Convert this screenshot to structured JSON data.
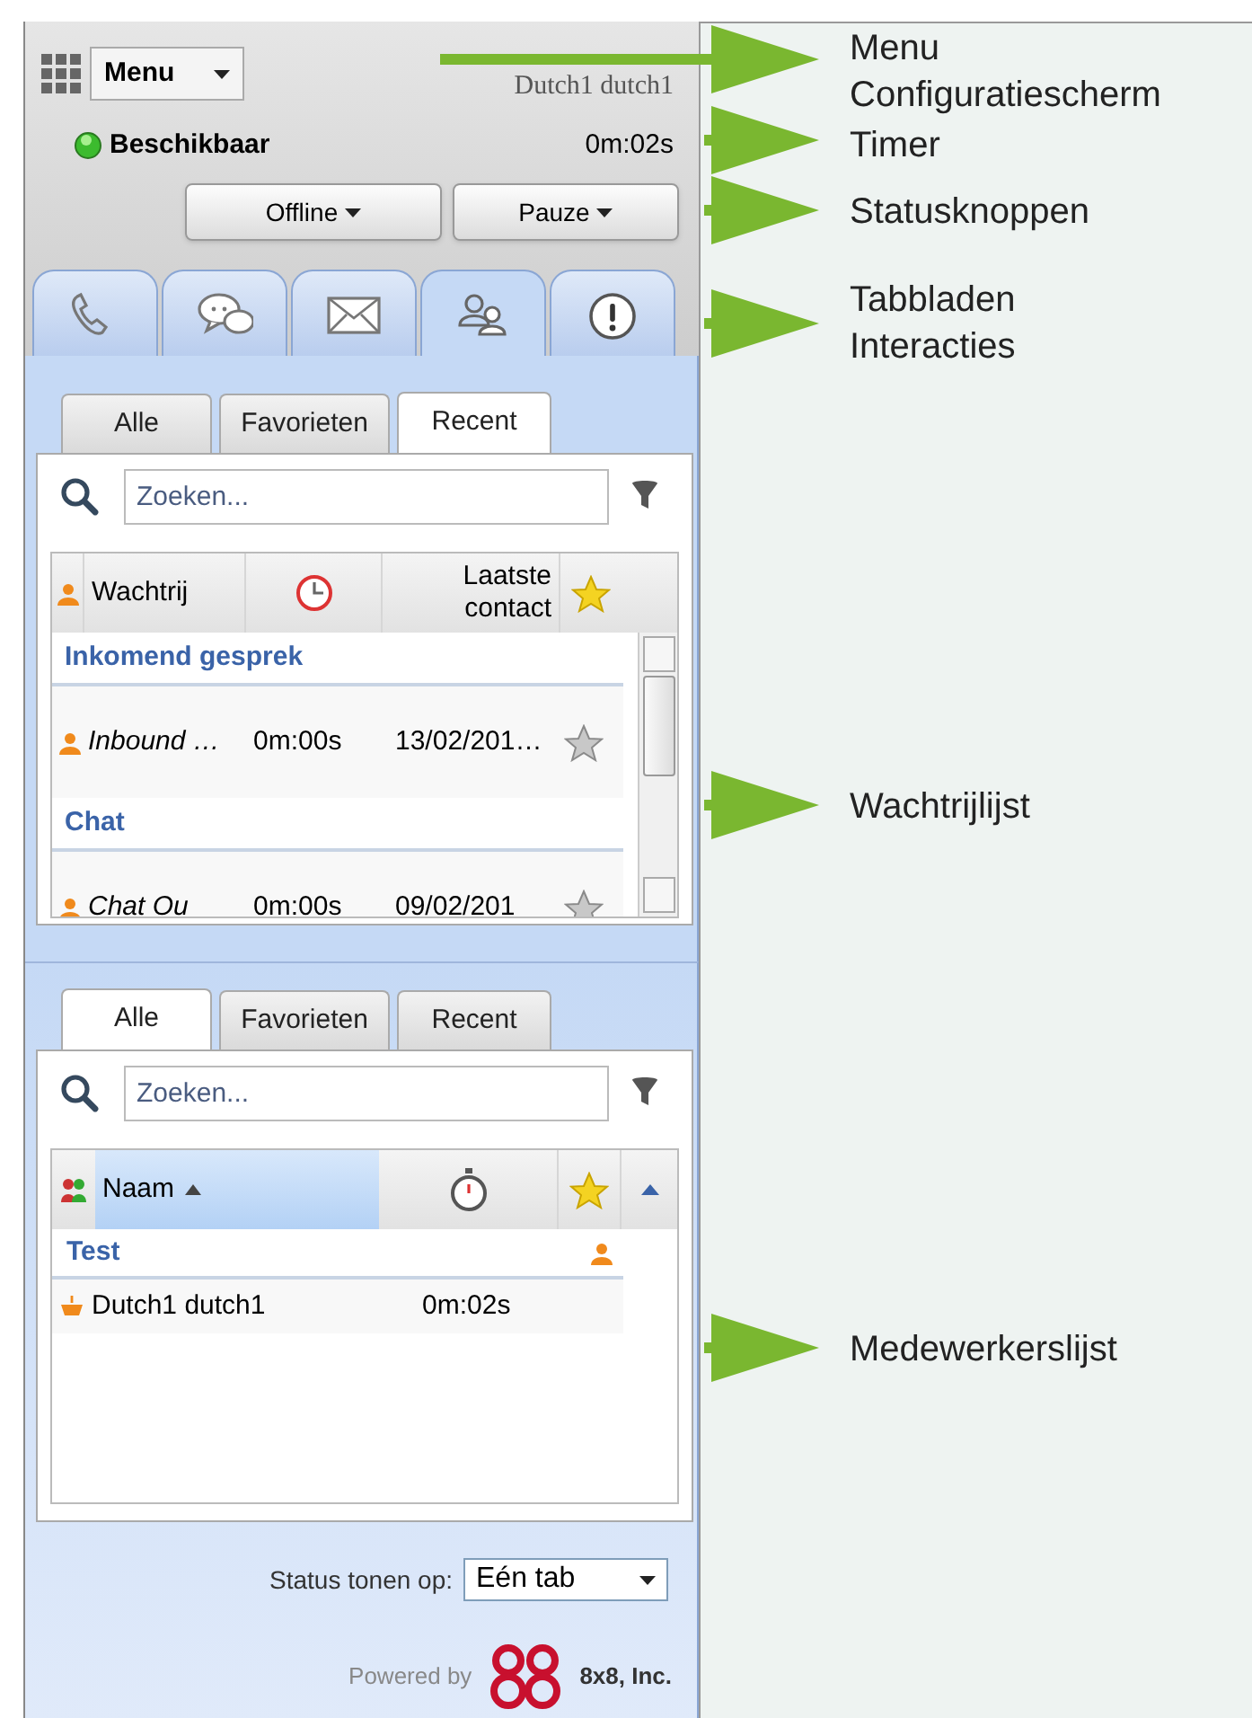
{
  "header": {
    "menu_button": "Menu",
    "user_name": "Dutch1 dutch1"
  },
  "status": {
    "label": "Beschikbaar",
    "timer": "0m:02s"
  },
  "status_buttons": [
    "Offline",
    "Pauze"
  ],
  "interaction_tabs": [
    {
      "kind": "phone",
      "selected": false
    },
    {
      "kind": "chat",
      "selected": false
    },
    {
      "kind": "mail",
      "selected": false
    },
    {
      "kind": "agents",
      "selected": true
    },
    {
      "kind": "alert",
      "selected": false
    }
  ],
  "queue_list": {
    "tabs": [
      {
        "label": "Alle",
        "selected": false
      },
      {
        "label": "Favorieten",
        "selected": false
      },
      {
        "label": "Recent",
        "selected": true
      }
    ],
    "search": {
      "placeholder": "Zoeken..."
    },
    "columns": {
      "queue": "Wachtrij",
      "last_contact": "Laatste contact"
    },
    "groups": [
      {
        "title": "Inkomend gesprek",
        "rows": [
          {
            "name": "Inbound …",
            "time": "0m:00s",
            "last_contact": "13/02/201…",
            "favorite": false
          }
        ]
      },
      {
        "title": "Chat",
        "rows": [
          {
            "name": "Chat Ou",
            "time": "0m:00s",
            "last_contact": "09/02/201",
            "favorite": false
          }
        ]
      }
    ]
  },
  "agent_list": {
    "tabs": [
      {
        "label": "Alle",
        "selected": true
      },
      {
        "label": "Favorieten",
        "selected": false
      },
      {
        "label": "Recent",
        "selected": false
      }
    ],
    "search": {
      "placeholder": "Zoeken..."
    },
    "columns": {
      "name": "Naam"
    },
    "groups": [
      {
        "title": "Test",
        "rows": [
          {
            "name": "Dutch1 dutch1",
            "time": "0m:02s"
          }
        ]
      }
    ]
  },
  "status_display": {
    "label": "Status tonen op:",
    "value": "Eén tab"
  },
  "footer": {
    "powered_by": "Powered by",
    "company": "8x8, Inc."
  },
  "annotations": [
    {
      "label": "Menu\nConfiguratiescherm"
    },
    {
      "label": "Timer"
    },
    {
      "label": "Statusknoppen"
    },
    {
      "label": "Tabbladen\nInteracties"
    },
    {
      "label": "Wachtrijlijst"
    },
    {
      "label": "Medewerkerslijst"
    }
  ]
}
